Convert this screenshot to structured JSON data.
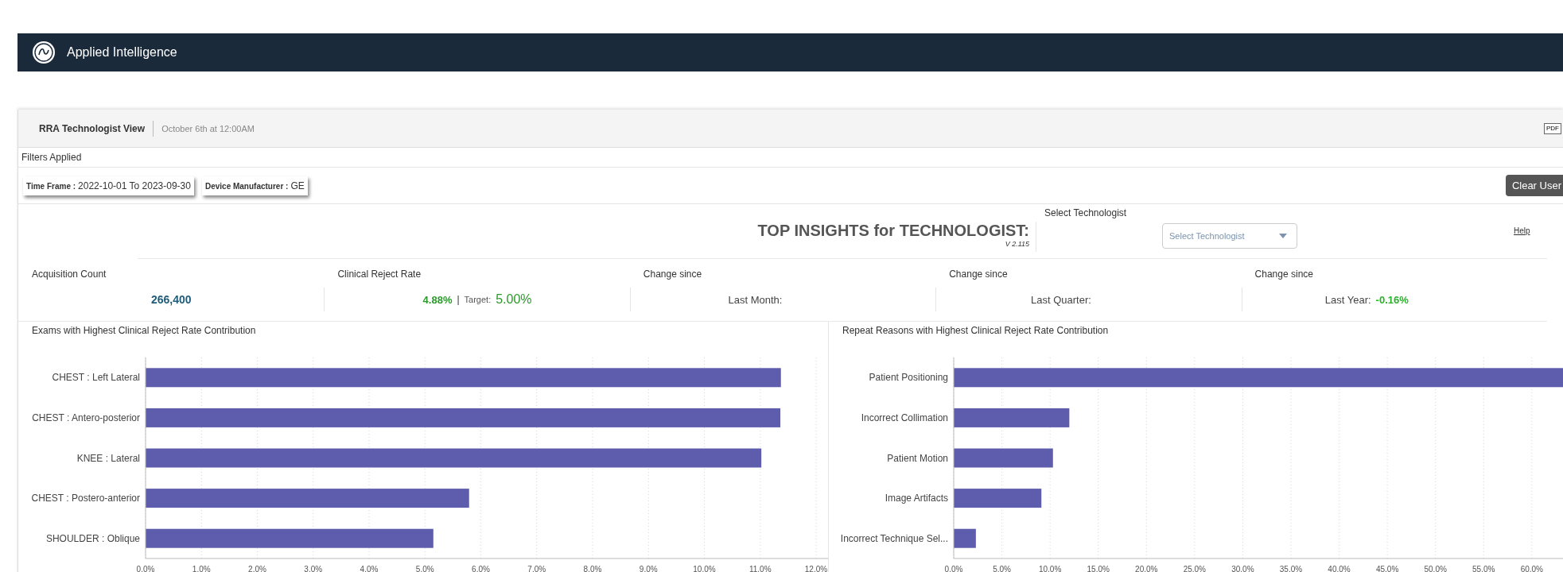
{
  "app_bar": {
    "title": "Applied Intelligence"
  },
  "report": {
    "title": "RRA Technologist View",
    "timestamp": "October 6th at 12:00AM",
    "export": "PDF"
  },
  "filters": {
    "heading": "Filters Applied",
    "chips": [
      {
        "label": "Time Frame :",
        "value": "2022-10-01 To 2023-09-30"
      },
      {
        "label": "Device Manufacturer :",
        "value": "GE"
      }
    ],
    "clear_button": "Clear User"
  },
  "insights": {
    "title": "TOP INSIGHTS for TECHNOLOGIST:",
    "version": "V 2.115",
    "select_label": "Select Technologist",
    "select_placeholder": "Select Technologist",
    "help": "Help"
  },
  "kpis": [
    {
      "kind": "count",
      "label": "Acquisition Count",
      "value": "266,400"
    },
    {
      "kind": "rate",
      "label": "Clinical Reject Rate",
      "value": "4.88%",
      "separator": "|",
      "target_label": "Target:",
      "target": "5.00%"
    },
    {
      "kind": "change",
      "label": "Change since",
      "period": "Last Month:"
    },
    {
      "kind": "change",
      "label": "Change since",
      "period": "Last Quarter:"
    },
    {
      "kind": "change",
      "label": "Change since",
      "period": "Last Year:",
      "value": "-0.16%"
    }
  ],
  "charts": [
    {
      "title": "Exams with Highest Clinical Reject Rate Contribution",
      "chart_data": {
        "type": "bar",
        "orientation": "horizontal",
        "categories": [
          "CHEST : Left Lateral",
          "CHEST : Antero-posterior",
          "KNEE : Lateral",
          "CHEST : Postero-anterior",
          "SHOULDER : Oblique"
        ],
        "series": [
          {
            "color": "#5e5cad",
            "values": [
              11.37,
              11.36,
              11.02,
              5.79,
              5.15
            ]
          }
        ],
        "grid": true,
        "xlim": [
          0,
          12
        ],
        "xticks": [
          {
            "value": 0,
            "label": "0.0%"
          },
          {
            "value": 1,
            "label": "1.0%"
          },
          {
            "value": 2,
            "label": "2.0%"
          },
          {
            "value": 3,
            "label": "3.0%"
          },
          {
            "value": 4,
            "label": "4.0%"
          },
          {
            "value": 5,
            "label": "5.0%"
          },
          {
            "value": 6,
            "label": "6.0%"
          },
          {
            "value": 7,
            "label": "7.0%"
          },
          {
            "value": 8,
            "label": "8.0%"
          },
          {
            "value": 9,
            "label": "9.0%"
          },
          {
            "value": 10,
            "label": "10.0%"
          },
          {
            "value": 11,
            "label": "11.0%"
          },
          {
            "value": 12,
            "label": "12.0%"
          }
        ]
      }
    },
    {
      "title": "Repeat Reasons with Highest Clinical Reject Rate Contribution",
      "chart_data": {
        "type": "bar",
        "orientation": "horizontal",
        "categories": [
          "Patient Positioning",
          "Incorrect Collimation",
          "Patient Motion",
          "Image Artifacts",
          "Incorrect Technique Sel..."
        ],
        "series": [
          {
            "color": "#5e5cad",
            "values": [
              63.4,
              12.0,
              10.3,
              9.1,
              2.3
            ]
          }
        ],
        "grid": true,
        "xlim": [
          0,
          63.4
        ],
        "xticks": [
          {
            "value": 0,
            "label": "0.0%"
          },
          {
            "value": 5,
            "label": "5.0%"
          },
          {
            "value": 10,
            "label": "10.0%"
          },
          {
            "value": 15,
            "label": "15.0%"
          },
          {
            "value": 20,
            "label": "20.0%"
          },
          {
            "value": 25,
            "label": "25.0%"
          },
          {
            "value": 30,
            "label": "30.0%"
          },
          {
            "value": 35,
            "label": "35.0%"
          },
          {
            "value": 40,
            "label": "40.0%"
          },
          {
            "value": 45,
            "label": "45.0%"
          },
          {
            "value": 50,
            "label": "50.0%"
          },
          {
            "value": 55,
            "label": "55.0%"
          },
          {
            "value": 60,
            "label": "60.0%"
          }
        ]
      }
    }
  ]
}
